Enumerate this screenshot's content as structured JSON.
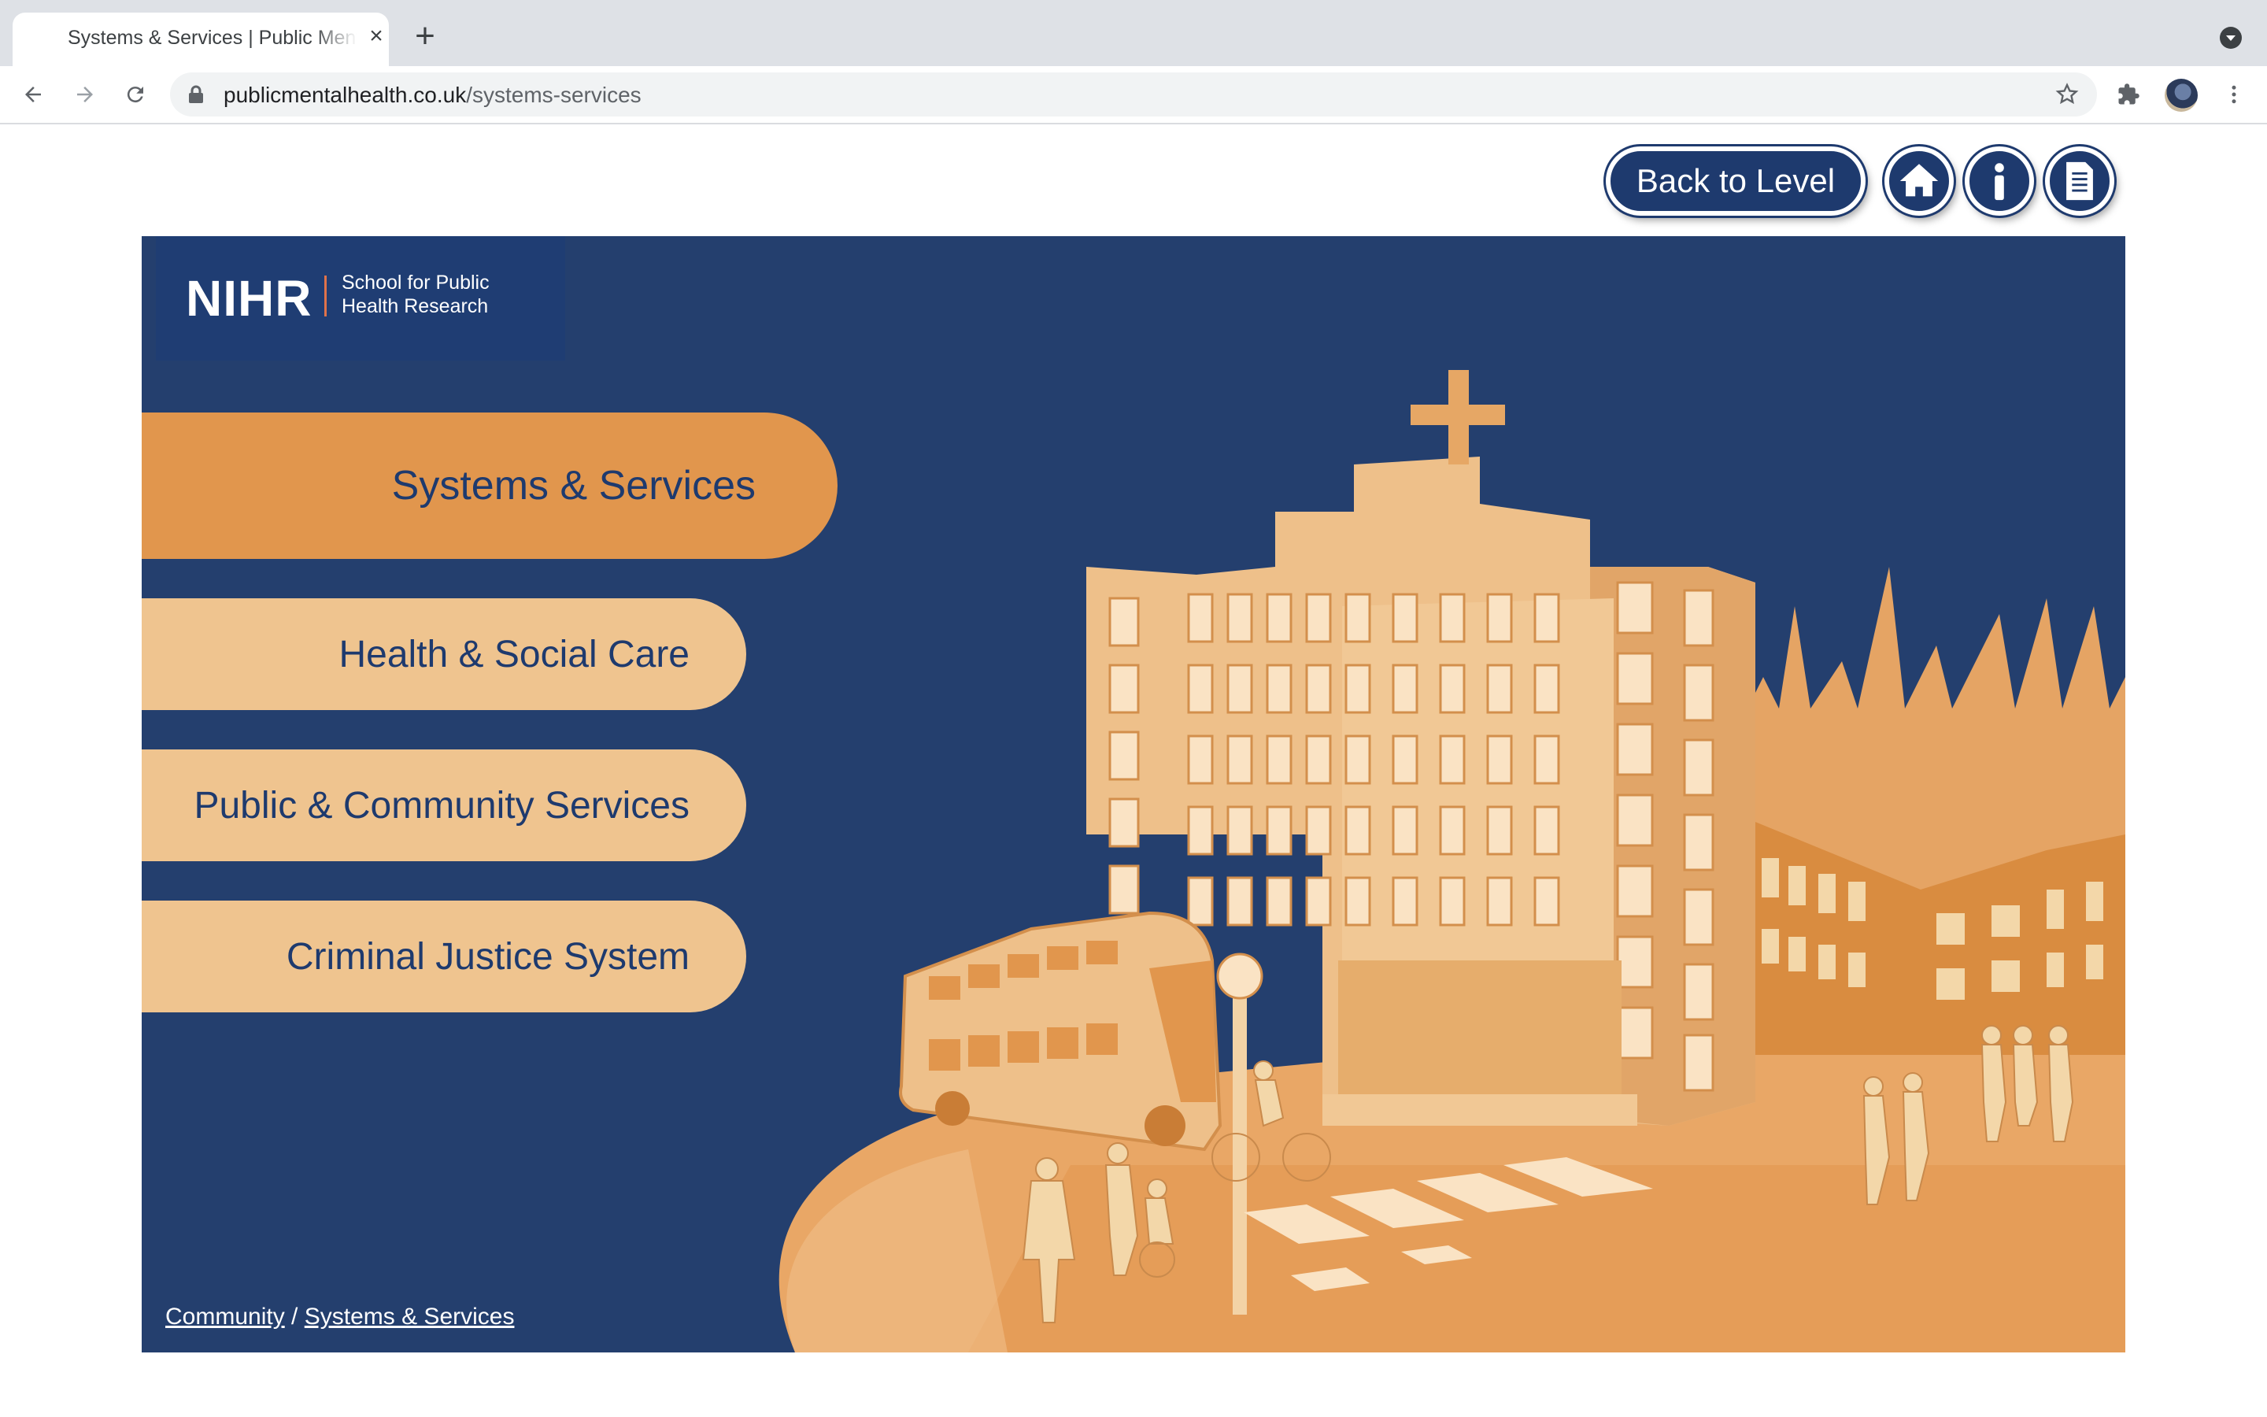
{
  "browser": {
    "tab_title": "Systems & Services | Public Mental Health",
    "url_host": "publicmentalhealth.co.uk",
    "url_path": "/systems-services"
  },
  "header": {
    "back_label": "Back to Level"
  },
  "logo": {
    "brand": "NIHR",
    "subtitle_line1": "School for Public",
    "subtitle_line2": "Health Research"
  },
  "menu": {
    "active": "Systems & Services",
    "items": [
      "Health & Social Care",
      "Public & Community Services",
      "Criminal Justice System"
    ]
  },
  "breadcrumb": {
    "parent": "Community",
    "separator": "/",
    "current": "Systems & Services"
  },
  "colors": {
    "navy": "#1e3a6e",
    "panel": "#243f6e",
    "active_pill": "#e1964d",
    "pill": "#efc48f",
    "illustration": "#e9a766"
  },
  "icons": [
    "back-arrow-icon",
    "forward-arrow-icon",
    "reload-icon",
    "lock-icon",
    "star-icon",
    "extensions-icon",
    "menu-dots-icon",
    "home-icon",
    "info-icon",
    "document-icon"
  ]
}
